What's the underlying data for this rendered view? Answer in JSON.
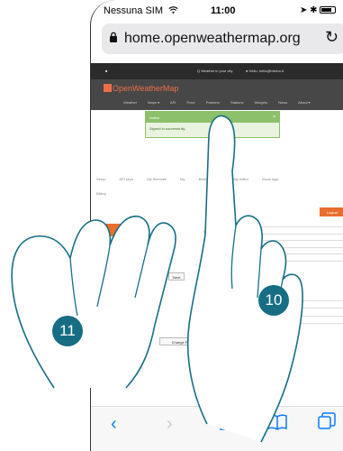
{
  "status_bar": {
    "carrier": "Nessuna SIM",
    "time": "11:00",
    "right_icons": "➤ ✱"
  },
  "browser": {
    "url": "home.openweathermap.org"
  },
  "site": {
    "topbar_left": "■",
    "topbar_mid": "Q Weather in your city",
    "topbar_right": "● Hello, hello@bticino.it",
    "logo": "OpenWeatherMap",
    "nav_items": [
      "Weather",
      "Maps ▾",
      "API",
      "Price",
      "Partners",
      "Stations",
      "Widgets",
      "News",
      "About ▾"
    ],
    "alert_title": "Notice",
    "alert_close": "×",
    "alert_message": "Signed in successfully.",
    "tabs": [
      "Setup",
      "API keys",
      "My Services",
      "My",
      "Billing plans",
      "Map editor",
      "Block logs"
    ],
    "tabs_row2": "Billing",
    "logout_label": "Logout",
    "username_label": "Username",
    "email_label": "Email",
    "email_value": "hello@bticino.it",
    "fullname_label": "Full name",
    "save_label": "Save",
    "password_label": "Password",
    "confirm_label": "Confirm Password",
    "change_password_label": "Change Password"
  },
  "badges": {
    "left": "11",
    "right": "10"
  },
  "colors": {
    "orange": "#eb6e4b",
    "badge": "#176e84",
    "ios_blue": "#0a7aff"
  }
}
